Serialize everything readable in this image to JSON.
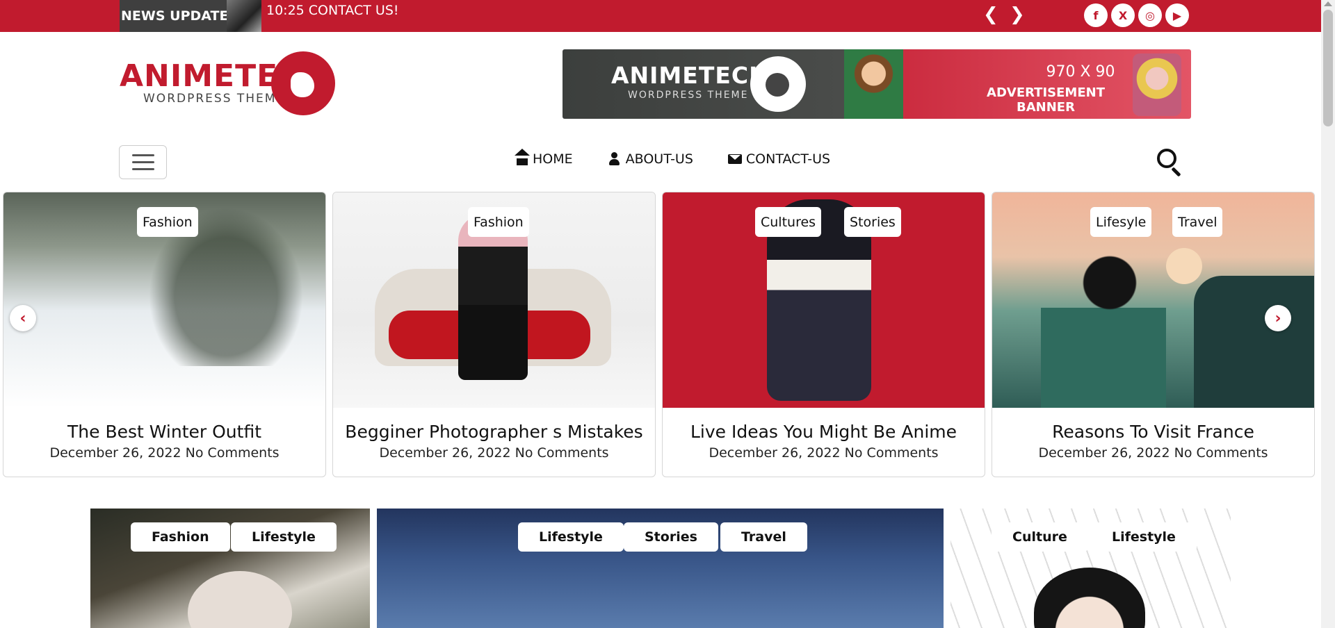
{
  "topbar": {
    "news_label": "NEWS UPDATES",
    "ticker_text": "10:25 CONTACT US!",
    "prev_icon": "chevron-left-icon",
    "next_icon": "chevron-right-icon",
    "social": [
      {
        "name": "facebook-icon",
        "glyph": "f"
      },
      {
        "name": "x-icon",
        "glyph": "X"
      },
      {
        "name": "instagram-icon",
        "glyph": "◎"
      },
      {
        "name": "youtube-icon",
        "glyph": "▶"
      }
    ]
  },
  "header": {
    "logo_title": "ANIMETECH",
    "logo_subtitle": "WORDPRESS THEME",
    "ad": {
      "logo_title": "ANIMETECH",
      "logo_subtitle": "WORDPRESS THEME",
      "size": "970 X 90",
      "label": "ADVERTISEMENT BANNER"
    }
  },
  "nav": {
    "items": [
      {
        "label": "HOME",
        "icon": "home-icon"
      },
      {
        "label": "ABOUT-US",
        "icon": "user-icon"
      },
      {
        "label": "CONTACT-US",
        "icon": "envelope-icon"
      }
    ]
  },
  "slider": {
    "cards": [
      {
        "badges": [
          "Fashion"
        ],
        "title": "The Best Winter Outfit",
        "date": "December 26, 2022",
        "comments": "No Comments"
      },
      {
        "badges": [
          "Fashion"
        ],
        "title": "Begginer Photographer s Mistakes",
        "date": "December 26, 2022",
        "comments": "No Comments"
      },
      {
        "badges": [
          "Cultures",
          "Stories"
        ],
        "title": "Live Ideas You Might Be Anime",
        "date": "December 26, 2022",
        "comments": "No Comments"
      },
      {
        "badges": [
          "Lifesyle",
          "Travel"
        ],
        "title": "Reasons To Visit France",
        "date": "December 26, 2022",
        "comments": "No Comments"
      }
    ],
    "prev_glyph": "‹",
    "next_glyph": "›"
  },
  "featured": {
    "cards": [
      {
        "badges": [
          "Fashion",
          "Lifestyle"
        ]
      },
      {
        "badges": [
          "Lifestyle",
          "Stories",
          "Travel"
        ]
      },
      {
        "badges": [
          "Culture",
          "Lifestyle"
        ]
      }
    ]
  },
  "colors": {
    "brand_red": "#c11b2e"
  }
}
